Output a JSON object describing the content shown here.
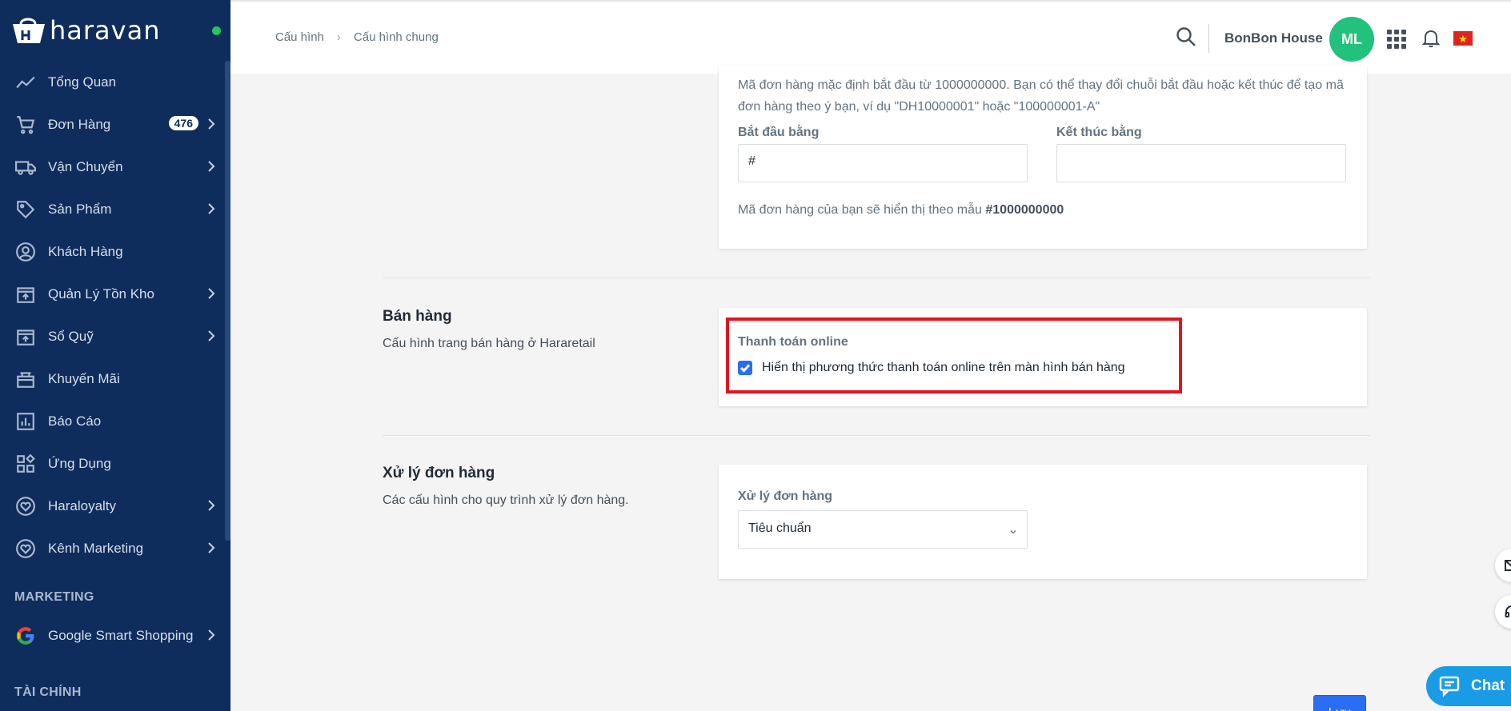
{
  "brand": {
    "name": "haravan"
  },
  "sidebar": {
    "items": [
      {
        "label": "Tổng Quan",
        "icon": "trend-icon",
        "chevron": false
      },
      {
        "label": "Đơn Hàng",
        "icon": "cart-icon",
        "chevron": true,
        "badge": "476"
      },
      {
        "label": "Vận Chuyển",
        "icon": "truck-icon",
        "chevron": true
      },
      {
        "label": "Sản Phẩm",
        "icon": "tag-icon",
        "chevron": true
      },
      {
        "label": "Khách Hàng",
        "icon": "user-icon",
        "chevron": false
      },
      {
        "label": "Quản Lý Tồn Kho",
        "icon": "inventory-icon",
        "chevron": true
      },
      {
        "label": "Sổ Quỹ",
        "icon": "cashbook-icon",
        "chevron": true
      },
      {
        "label": "Khuyến Mãi",
        "icon": "gift-icon",
        "chevron": false
      },
      {
        "label": "Báo Cáo",
        "icon": "report-icon",
        "chevron": false
      },
      {
        "label": "Ứng Dụng",
        "icon": "apps-icon",
        "chevron": false
      },
      {
        "label": "Haraloyalty",
        "icon": "heart-icon",
        "chevron": true
      },
      {
        "label": "Kênh Marketing",
        "icon": "heart-icon",
        "chevron": true
      }
    ],
    "marketing_label": "MARKETING",
    "marketing_item": {
      "label": "Google Smart Shopping",
      "icon": "google-icon"
    },
    "finance_label": "TÀI CHÍNH"
  },
  "topbar": {
    "breadcrumb": [
      "Cấu hình",
      "Cấu hình chung"
    ],
    "store_name": "BonBon House",
    "avatar_initials": "ML"
  },
  "order_code": {
    "description": "Mã đơn hàng mặc định bắt đầu từ 1000000000. Bạn có thể thay đổi chuỗi bắt đầu hoặc kết thúc để tạo mã đơn hàng theo ý bạn, ví dụ \"DH10000001\" hoặc \"100000001-A\"",
    "start_label": "Bắt đầu bằng",
    "start_value": "#",
    "end_label": "Kết thúc bằng",
    "end_value": "",
    "preview_text": "Mã đơn hàng của bạn sẽ hiển thị theo mẫu ",
    "preview_code": "#1000000000"
  },
  "sales": {
    "title": "Bán hàng",
    "description": "Cấu hình trang bán hàng ở Hararetail",
    "online_payment_label": "Thanh toán online",
    "online_payment_checkbox_label": "Hiển thị phương thức thanh toán online trên màn hình bán hàng",
    "online_payment_checked": true
  },
  "order_processing": {
    "title": "Xử lý đơn hàng",
    "description": "Các cấu hình cho quy trình xử lý đơn hàng.",
    "field_label": "Xử lý đơn hàng",
    "selected": "Tiêu chuẩn"
  },
  "actions": {
    "save_label": "Lưu"
  },
  "chat": {
    "label": "Chat"
  },
  "colors": {
    "sidebar": "#0f2d5c",
    "primary": "#2a6ef3",
    "highlight": "#e3141c",
    "avatar": "#22c17c"
  }
}
